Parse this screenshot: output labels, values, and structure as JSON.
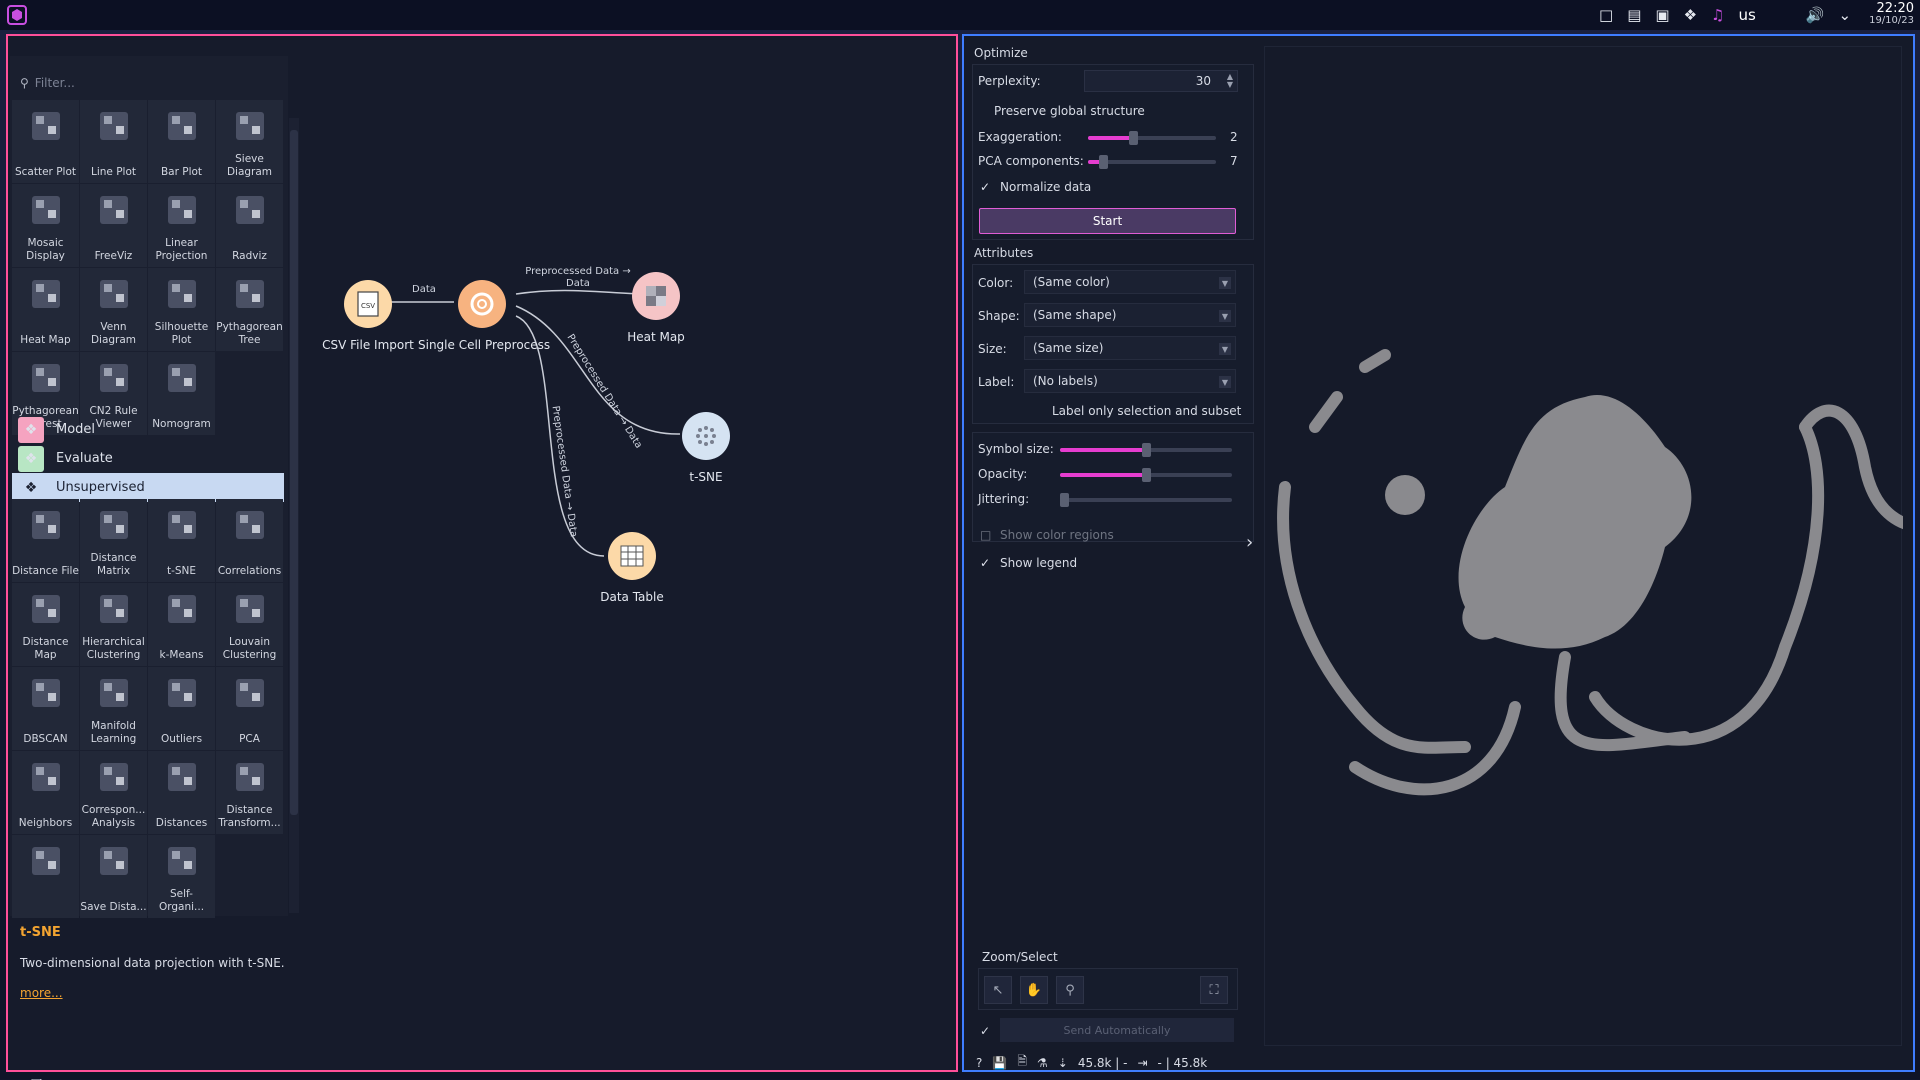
{
  "taskbar": {
    "keyboard_layout": "us",
    "time": "22:20",
    "date": "19/10/23",
    "icons": [
      "notification-icon",
      "terminal-icon",
      "clipboard-icon",
      "bluetooth-icon",
      "music-icon",
      "volume-icon",
      "chevron-down-icon"
    ]
  },
  "toolbox": {
    "filter_placeholder": "Filter...",
    "visualize_tiles": [
      {
        "label": "Scatter Plot",
        "icon": "scatter-plot-icon"
      },
      {
        "label": "Line Plot",
        "icon": "line-plot-icon"
      },
      {
        "label": "Bar Plot",
        "icon": "bar-plot-icon"
      },
      {
        "label": "Sieve Diagram",
        "icon": "sieve-diagram-icon"
      },
      {
        "label": "Mosaic Display",
        "icon": "mosaic-display-icon"
      },
      {
        "label": "FreeViz",
        "icon": "freeviz-icon"
      },
      {
        "label": "Linear Projection",
        "icon": "linear-projection-icon"
      },
      {
        "label": "Radviz",
        "icon": "radviz-icon"
      },
      {
        "label": "Heat Map",
        "icon": "heat-map-icon"
      },
      {
        "label": "Venn Diagram",
        "icon": "venn-diagram-icon"
      },
      {
        "label": "Silhouette Plot",
        "icon": "silhouette-plot-icon"
      },
      {
        "label": "Pythagorean Tree",
        "icon": "pythagorean-tree-icon"
      },
      {
        "label": "Pythagorean Forest",
        "icon": "pythagorean-forest-icon"
      },
      {
        "label": "CN2 Rule Viewer",
        "icon": "cn2-rule-viewer-icon"
      },
      {
        "label": "Nomogram",
        "icon": "nomogram-icon"
      }
    ],
    "categories": [
      {
        "label": "Model",
        "color": "#f5a3c0"
      },
      {
        "label": "Evaluate",
        "color": "#b8e6c4"
      },
      {
        "label": "Unsupervised",
        "color": "#c8d9f2"
      }
    ],
    "unsupervised_tiles": [
      {
        "label": "Distance File",
        "icon": "distance-file-icon"
      },
      {
        "label": "Distance Matrix",
        "icon": "distance-matrix-icon"
      },
      {
        "label": "t-SNE",
        "icon": "tsne-icon"
      },
      {
        "label": "Correlations",
        "icon": "correlations-icon"
      },
      {
        "label": "Distance Map",
        "icon": "distance-map-icon"
      },
      {
        "label": "Hierarchical Clustering",
        "icon": "hierarchical-clustering-icon"
      },
      {
        "label": "k-Means",
        "icon": "k-means-icon"
      },
      {
        "label": "Louvain Clustering",
        "icon": "louvain-clustering-icon"
      },
      {
        "label": "DBSCAN",
        "icon": "dbscan-icon"
      },
      {
        "label": "Manifold Learning",
        "icon": "manifold-learning-icon"
      },
      {
        "label": "Outliers",
        "icon": "outliers-icon"
      },
      {
        "label": "PCA",
        "icon": "pca-icon"
      },
      {
        "label": "Neighbors",
        "icon": "neighbors-icon"
      },
      {
        "label": "Correspon... Analysis",
        "icon": "correspondence-analysis-icon"
      },
      {
        "label": "Distances",
        "icon": "distances-icon"
      },
      {
        "label": "Distance Transform...",
        "icon": "distance-transformation-icon"
      },
      {
        "label": "",
        "icon": "mds-icon"
      },
      {
        "label": "Save Dista...",
        "icon": "save-distance-icon"
      },
      {
        "label": "Self-Organi...",
        "icon": "self-organizing-map-icon"
      }
    ],
    "help": {
      "title": "t-SNE",
      "description": "Two-dimensional data projection with t-SNE.",
      "more_link": "more..."
    },
    "bottom_tools": [
      "new-document-icon",
      "grid-icon",
      "text-icon",
      "pen-icon",
      "pause-icon",
      "help-icon"
    ]
  },
  "workflow": {
    "nodes": [
      {
        "label": "CSV File Import",
        "color": "#fcd9a8"
      },
      {
        "label": "Single Cell Preprocess",
        "color": "#f7b380"
      },
      {
        "label": "Heat Map",
        "color": "#f5c4c6"
      },
      {
        "label": "t-SNE",
        "color": "#d5e3f2"
      },
      {
        "label": "Data Table",
        "color": "#fcd9a8"
      }
    ],
    "edges": [
      {
        "label": "Data"
      },
      {
        "label": "Preprocessed Data → Data"
      },
      {
        "label": "Preprocessed Data → Data"
      },
      {
        "label": "Preprocessed Data → Data"
      }
    ]
  },
  "tsne": {
    "optimize_title": "Optimize",
    "perplexity_label": "Perplexity:",
    "perplexity_value": "30",
    "preserve_global": "Preserve global structure",
    "exaggeration_label": "Exaggeration:",
    "exaggeration_value": "2",
    "exaggeration_level": 0.35,
    "pca_label": "PCA components:",
    "pca_value": "7",
    "pca_level": 0.12,
    "normalize_label": "Normalize data",
    "normalize_checked": true,
    "start_label": "Start",
    "attributes_title": "Attributes",
    "color_label": "Color:",
    "color_value": "(Same color)",
    "shape_label": "Shape:",
    "shape_value": "(Same shape)",
    "size_label": "Size:",
    "size_value": "(Same size)",
    "label_label": "Label:",
    "label_value": "(No labels)",
    "label_only_selection": "Label only selection and subset",
    "symbol_size_label": "Symbol size:",
    "symbol_size_level": 0.5,
    "opacity_label": "Opacity:",
    "opacity_level": 0.5,
    "jittering_label": "Jittering:",
    "jittering_level": 0.0,
    "show_color_regions": "Show color regions",
    "show_legend": "Show legend",
    "show_legend_checked": true,
    "zoom_select_title": "Zoom/Select",
    "send_automatically": "Send Automatically",
    "status_in": "45.8k | -",
    "status_out": "- | 45.8k",
    "accent": "#e63dd0",
    "expand_icon": "chevron-right-icon"
  }
}
